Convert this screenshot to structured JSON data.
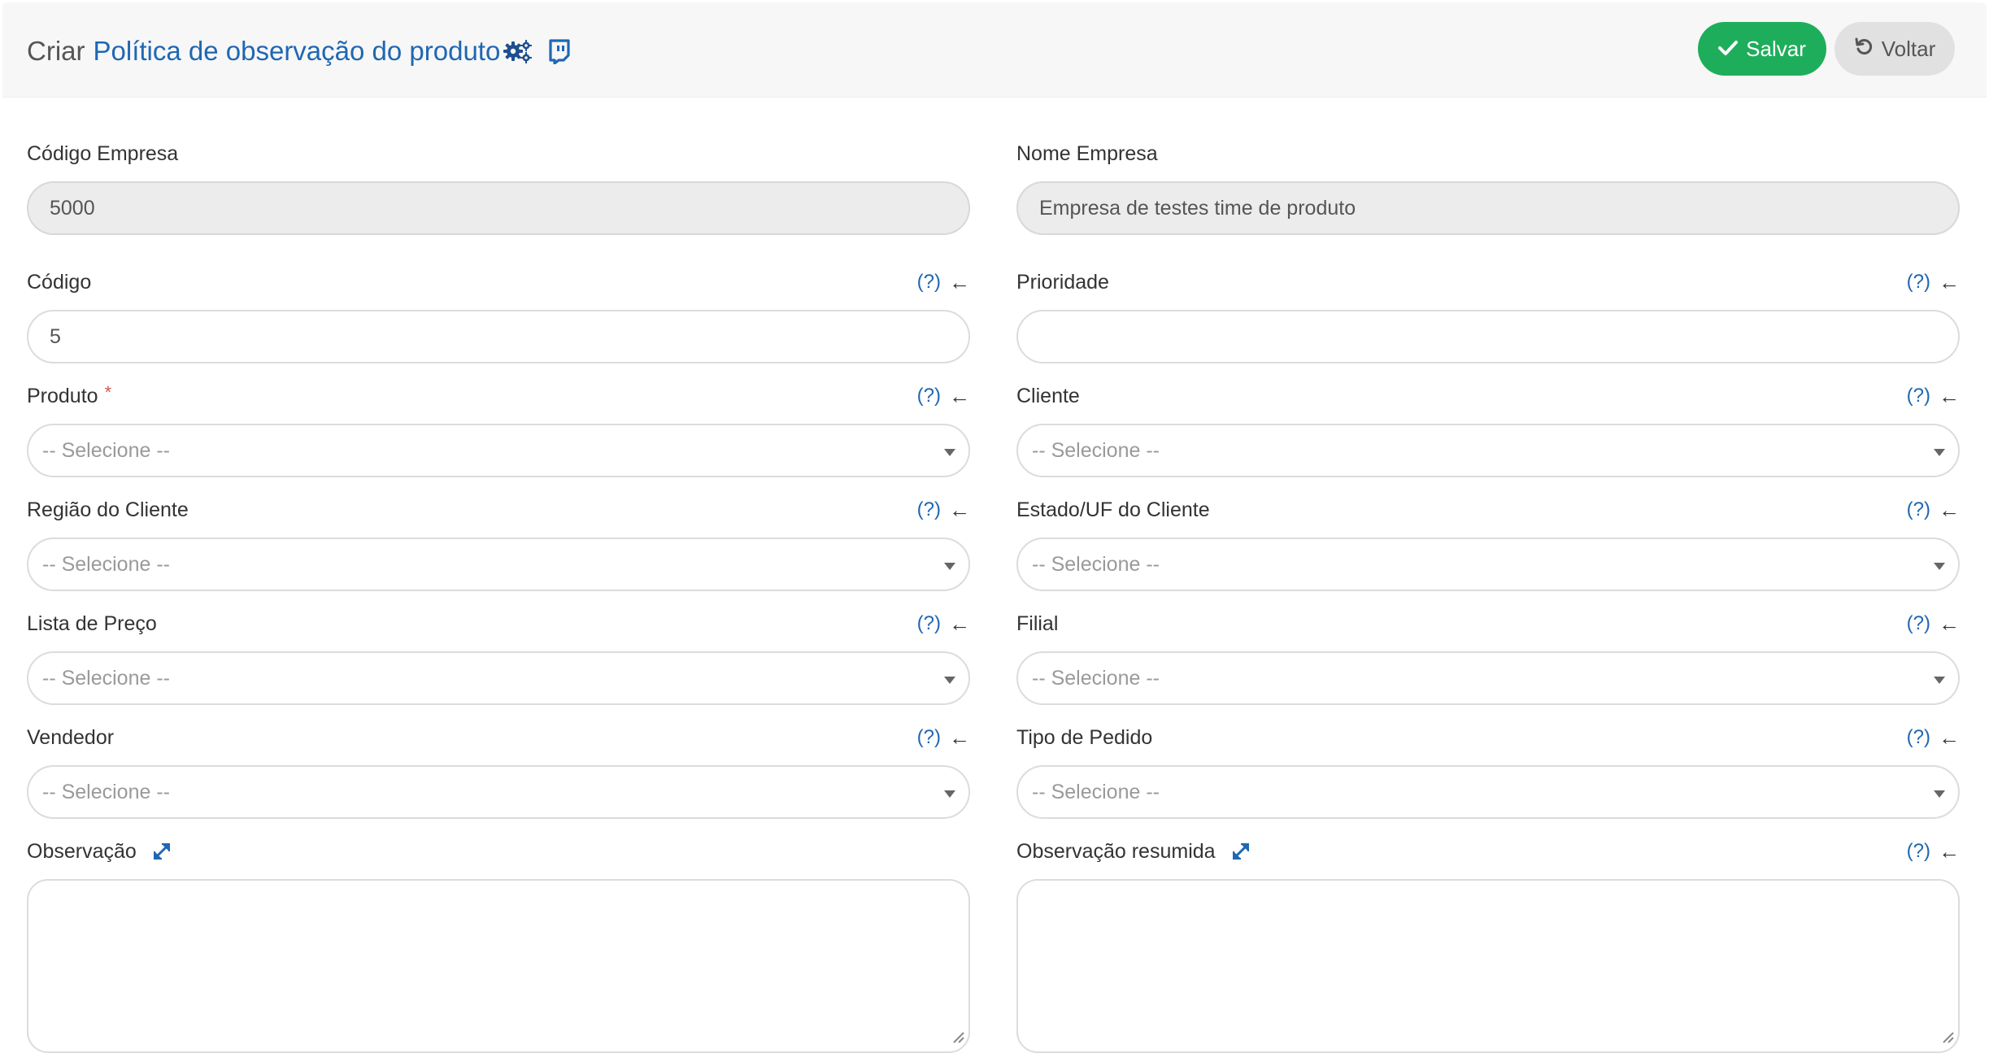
{
  "header": {
    "prefix": "Criar",
    "entity": "Política de observação do produto",
    "save_label": "Salvar",
    "back_label": "Voltar"
  },
  "help": {
    "q": "(?)",
    "arrow": "←"
  },
  "fields": {
    "codigo_empresa": {
      "label": "Código Empresa",
      "value": "5000"
    },
    "nome_empresa": {
      "label": "Nome Empresa",
      "value": "Empresa de testes time de produto"
    },
    "codigo": {
      "label": "Código",
      "value": "5"
    },
    "prioridade": {
      "label": "Prioridade",
      "value": ""
    },
    "produto": {
      "label": "Produto",
      "required": "*",
      "placeholder": "-- Selecione --"
    },
    "cliente": {
      "label": "Cliente",
      "placeholder": "-- Selecione --"
    },
    "regiao_cliente": {
      "label": "Região do Cliente",
      "placeholder": "-- Selecione --"
    },
    "estado_cliente": {
      "label": "Estado/UF do Cliente",
      "placeholder": "-- Selecione --"
    },
    "lista_preco": {
      "label": "Lista de Preço",
      "placeholder": "-- Selecione --"
    },
    "filial": {
      "label": "Filial",
      "placeholder": "-- Selecione --"
    },
    "vendedor": {
      "label": "Vendedor",
      "placeholder": "-- Selecione --"
    },
    "tipo_pedido": {
      "label": "Tipo de Pedido",
      "placeholder": "-- Selecione --"
    },
    "observacao": {
      "label": "Observação",
      "value": ""
    },
    "observacao_resumida": {
      "label": "Observação resumida",
      "value": ""
    }
  },
  "colors": {
    "accent": "#1f67b3",
    "save": "#1eae5b",
    "back": "#e1e1e1",
    "required": "#d9534f"
  },
  "icons": [
    "gears-icon",
    "chat-icon",
    "check-icon",
    "undo-icon",
    "expand-icon",
    "caret-down-icon",
    "resize-grip-icon"
  ]
}
